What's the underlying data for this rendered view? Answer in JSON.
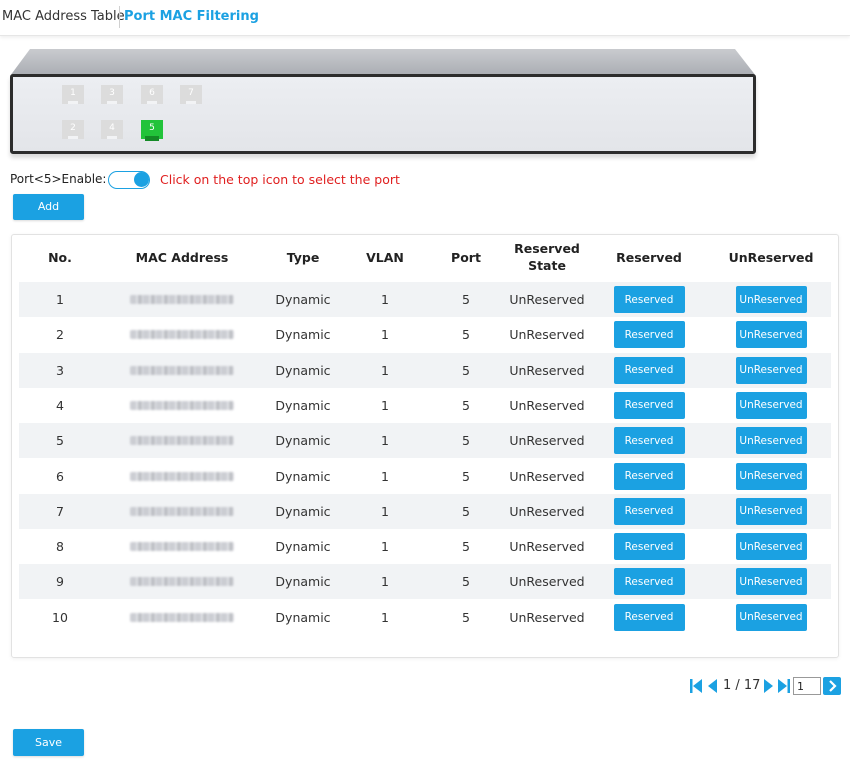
{
  "tabs": [
    {
      "label": "MAC Address Table",
      "active": false
    },
    {
      "label": "Port MAC Filtering",
      "active": true
    }
  ],
  "device": {
    "ports": [
      {
        "label": "1",
        "selected": false
      },
      {
        "label": "2",
        "selected": false
      },
      {
        "label": "3",
        "selected": false
      },
      {
        "label": "4",
        "selected": false
      },
      {
        "label": "6",
        "selected": false
      },
      {
        "label": "5",
        "selected": true
      },
      {
        "label": "7",
        "selected": false
      }
    ]
  },
  "enable": {
    "label": "Port<5>Enable:",
    "enabled": true,
    "hint": "Click on the top icon to select the port"
  },
  "buttons": {
    "add": "Add",
    "save": "Save"
  },
  "table": {
    "headers": [
      "No.",
      "MAC Address",
      "Type",
      "VLAN",
      "Port",
      "Reserved State",
      "Reserved",
      "UnReserved"
    ],
    "rows": [
      {
        "no": "1",
        "type": "Dynamic",
        "vlan": "1",
        "port": "5",
        "state": "UnReserved",
        "reserved_btn": "Reserved",
        "unreserved_btn": "UnReserved"
      },
      {
        "no": "2",
        "type": "Dynamic",
        "vlan": "1",
        "port": "5",
        "state": "UnReserved",
        "reserved_btn": "Reserved",
        "unreserved_btn": "UnReserved"
      },
      {
        "no": "3",
        "type": "Dynamic",
        "vlan": "1",
        "port": "5",
        "state": "UnReserved",
        "reserved_btn": "Reserved",
        "unreserved_btn": "UnReserved"
      },
      {
        "no": "4",
        "type": "Dynamic",
        "vlan": "1",
        "port": "5",
        "state": "UnReserved",
        "reserved_btn": "Reserved",
        "unreserved_btn": "UnReserved"
      },
      {
        "no": "5",
        "type": "Dynamic",
        "vlan": "1",
        "port": "5",
        "state": "UnReserved",
        "reserved_btn": "Reserved",
        "unreserved_btn": "UnReserved"
      },
      {
        "no": "6",
        "type": "Dynamic",
        "vlan": "1",
        "port": "5",
        "state": "UnReserved",
        "reserved_btn": "Reserved",
        "unreserved_btn": "UnReserved"
      },
      {
        "no": "7",
        "type": "Dynamic",
        "vlan": "1",
        "port": "5",
        "state": "UnReserved",
        "reserved_btn": "Reserved",
        "unreserved_btn": "UnReserved"
      },
      {
        "no": "8",
        "type": "Dynamic",
        "vlan": "1",
        "port": "5",
        "state": "UnReserved",
        "reserved_btn": "Reserved",
        "unreserved_btn": "UnReserved"
      },
      {
        "no": "9",
        "type": "Dynamic",
        "vlan": "1",
        "port": "5",
        "state": "UnReserved",
        "reserved_btn": "Reserved",
        "unreserved_btn": "UnReserved"
      },
      {
        "no": "10",
        "type": "Dynamic",
        "vlan": "1",
        "port": "5",
        "state": "UnReserved",
        "reserved_btn": "Reserved",
        "unreserved_btn": "UnReserved"
      }
    ]
  },
  "pagination": {
    "page_info": "1 / 17",
    "input_value": "1"
  },
  "colors": {
    "accent": "#1ba1e2",
    "hint": "#e02020",
    "port_selected": "#22c33a",
    "row_shade": "#f1f3f5"
  },
  "icons": [
    "first-page-icon",
    "prev-page-icon",
    "next-page-icon",
    "last-page-icon",
    "go-arrow-icon"
  ]
}
